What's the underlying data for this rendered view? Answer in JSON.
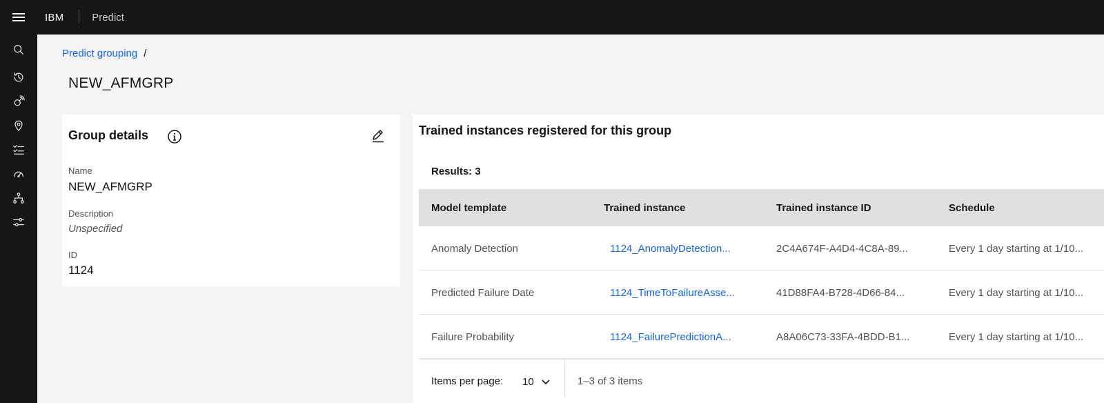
{
  "header": {
    "menu_icon": "hamburger-menu-icon",
    "brand": "IBM",
    "product": "Predict"
  },
  "sidenav": {
    "icons": [
      "search-icon",
      "history-icon",
      "satellite-icon",
      "location-icon",
      "checklist-icon",
      "gauge-icon",
      "hierarchy-icon",
      "sliders-icon"
    ]
  },
  "breadcrumb": {
    "link": "Predict grouping",
    "separator": "/"
  },
  "page": {
    "title": "NEW_AFMGRP"
  },
  "details": {
    "title": "Group details",
    "info_icon": "info-icon",
    "edit_icon": "edit-icon",
    "name_label": "Name",
    "name_value": "NEW_AFMGRP",
    "description_label": "Description",
    "description_value": "Unspecified",
    "id_label": "ID",
    "id_value": "1124"
  },
  "table": {
    "title": "Trained instances registered for this group",
    "results": "Results: 3",
    "columns": [
      "Model template",
      "Trained instance",
      "Trained instance ID",
      "Schedule"
    ],
    "rows": [
      {
        "model": "Anomaly Detection",
        "instance": "1124_AnomalyDetection...",
        "instance_id": "2C4A674F-A4D4-4C8A-89...",
        "schedule": "Every 1 day starting at 1/10..."
      },
      {
        "model": "Predicted Failure Date",
        "instance": "1124_TimeToFailureAsse...",
        "instance_id": "41D88FA4-B728-4D66-84...",
        "schedule": "Every 1 day starting at 1/10..."
      },
      {
        "model": "Failure Probability",
        "instance": "1124_FailurePredictionA...",
        "instance_id": "A8A06C73-33FA-4BDD-B1...",
        "schedule": "Every 1 day starting at 1/10..."
      }
    ],
    "pagination": {
      "items_per_page_label": "Items per page:",
      "items_per_page_value": "10",
      "range": "1–3 of 3 items"
    }
  }
}
